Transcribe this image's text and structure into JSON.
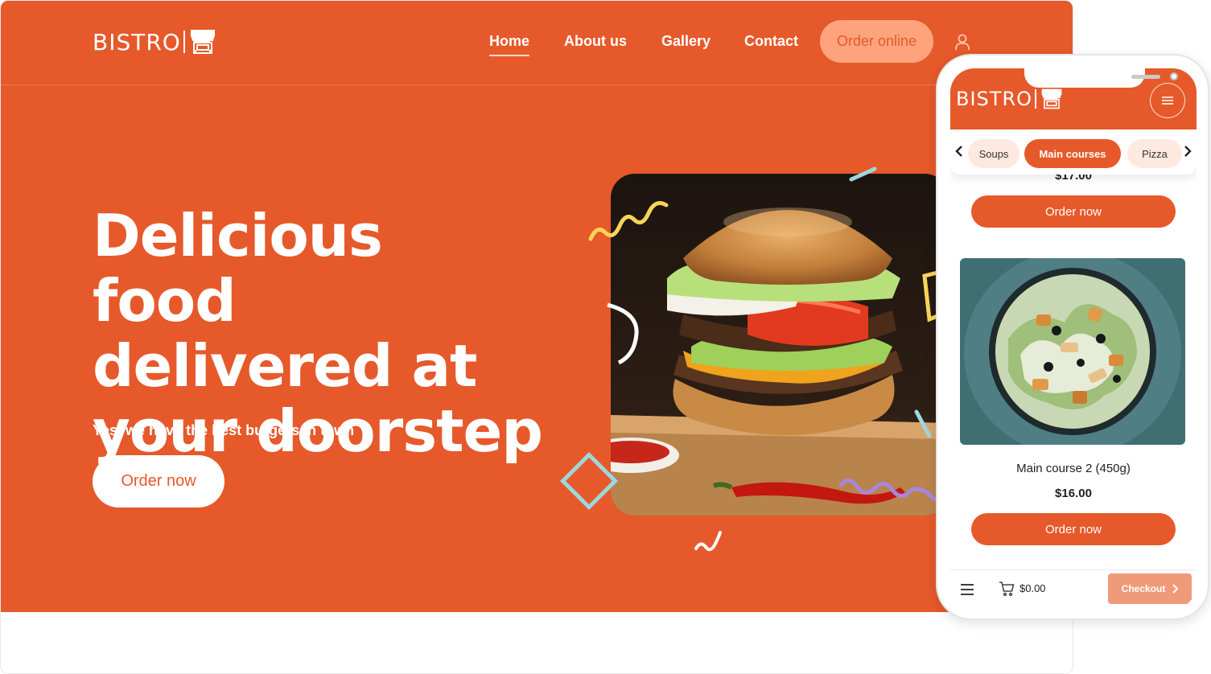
{
  "brand": {
    "name": "BISTRO"
  },
  "nav": {
    "items": [
      {
        "label": "Home",
        "active": true
      },
      {
        "label": "About us",
        "active": false
      },
      {
        "label": "Gallery",
        "active": false
      },
      {
        "label": "Contact",
        "active": false
      }
    ],
    "cta_label": "Order online",
    "user_icon": "user-icon"
  },
  "hero": {
    "headline_lines": [
      "Delicious food",
      "delivered at",
      "your doorstep"
    ],
    "subhead": "Yes, we have the best burgers in town",
    "button_label": "Order now",
    "image": "burger-photo"
  },
  "mobile": {
    "brand": "BISTRO",
    "menu_icon": "hamburger-menu-icon",
    "categories": [
      {
        "label": "Soups",
        "active": false
      },
      {
        "label": "Main courses",
        "active": true
      },
      {
        "label": "Pizza",
        "active": false
      }
    ],
    "previous_price": "$17.00",
    "order_button_label": "Order now",
    "product": {
      "name": "Main course 2 (450g)",
      "price": "$16.00",
      "image": "caesar-salad-photo"
    },
    "footer": {
      "cart_total": "$0.00",
      "checkout_label": "Checkout"
    }
  },
  "colors": {
    "brand_orange": "#e6592a",
    "soft_orange": "#ffa37d",
    "checkout_orange": "#f19a79",
    "pill_inactive": "#fde9df"
  }
}
